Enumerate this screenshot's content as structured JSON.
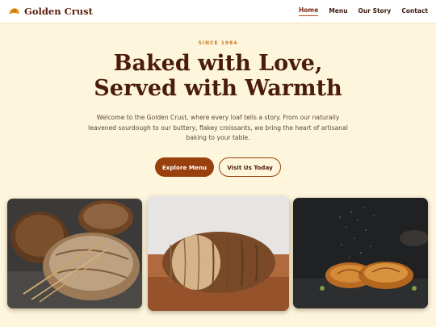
{
  "nav": {
    "brand": "Golden Crust",
    "brand_icon": "croissant-icon",
    "links": [
      {
        "label": "Home",
        "active": true
      },
      {
        "label": "Menu",
        "active": false
      },
      {
        "label": "Our Story",
        "active": false
      },
      {
        "label": "Contact",
        "active": false
      }
    ]
  },
  "hero": {
    "eyebrow": "SINCE 1984",
    "headline_line1": "Baked with Love,",
    "headline_line2": "Served with Warmth",
    "intro_line1": "Welcome to the Golden Crust, where every loaf tells a story. From our naturally",
    "intro_line2": "leavened sourdough to our buttery, flakey croissants, we bring the heart of artisanal",
    "intro_line3": "baking to your table.",
    "primary_button": "Explore Menu",
    "secondary_button": "Visit Us Today"
  },
  "gallery": [
    {
      "subject": "rustic-bread-loaves-photo"
    },
    {
      "subject": "sliced-bread-loaf-photo"
    },
    {
      "subject": "croissants-flour-dusting-photo"
    }
  ],
  "colors": {
    "background": "#fdf5dc",
    "brand_text": "#5a1d0c",
    "accent": "#99400f",
    "eyebrow": "#c67a20",
    "headline": "#4b1c0b"
  }
}
